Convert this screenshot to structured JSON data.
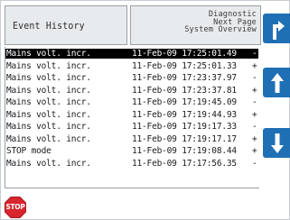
{
  "header": {
    "title": "Event History",
    "menu": [
      "Diagnostic",
      "Next Page",
      "System Overview"
    ]
  },
  "nav": {
    "top_icon": "corner-up-right-arrow-icon",
    "up_icon": "arrow-up-icon",
    "down_icon": "arrow-down-icon",
    "button_color": "#1f6fb5"
  },
  "events": [
    {
      "event": "Mains volt. incr.",
      "time": "11-Feb-09 17:25:01.49",
      "sign": "-",
      "selected": true
    },
    {
      "event": "Mains volt. incr.",
      "time": "11-Feb-09 17:25:01.33",
      "sign": "+",
      "selected": false
    },
    {
      "event": "Mains volt. incr.",
      "time": "11-Feb-09 17:23:37.97",
      "sign": "-",
      "selected": false
    },
    {
      "event": "Mains volt. incr.",
      "time": "11-Feb-09 17:23:37.81",
      "sign": "+",
      "selected": false
    },
    {
      "event": "Mains volt. incr.",
      "time": "11-Feb-09 17:19:45.09",
      "sign": "-",
      "selected": false
    },
    {
      "event": "Mains volt. incr.",
      "time": "11-Feb-09 17:19:44.93",
      "sign": "+",
      "selected": false
    },
    {
      "event": "Mains volt. incr.",
      "time": "11-Feb-09 17:19:17.33",
      "sign": "-",
      "selected": false
    },
    {
      "event": "Mains volt. incr.",
      "time": "11-Feb-09 17:19:17.17",
      "sign": "+",
      "selected": false
    },
    {
      "event": "STOP mode",
      "time": "11-Feb-09 17:19:08.44",
      "sign": "+",
      "selected": false
    },
    {
      "event": "Mains volt. incr.",
      "time": "11-Feb-09 17:17:56.35",
      "sign": "-",
      "selected": false
    }
  ],
  "stop": {
    "label": "STOP",
    "icon": "stop-sign-icon",
    "color": "#d8262e"
  }
}
